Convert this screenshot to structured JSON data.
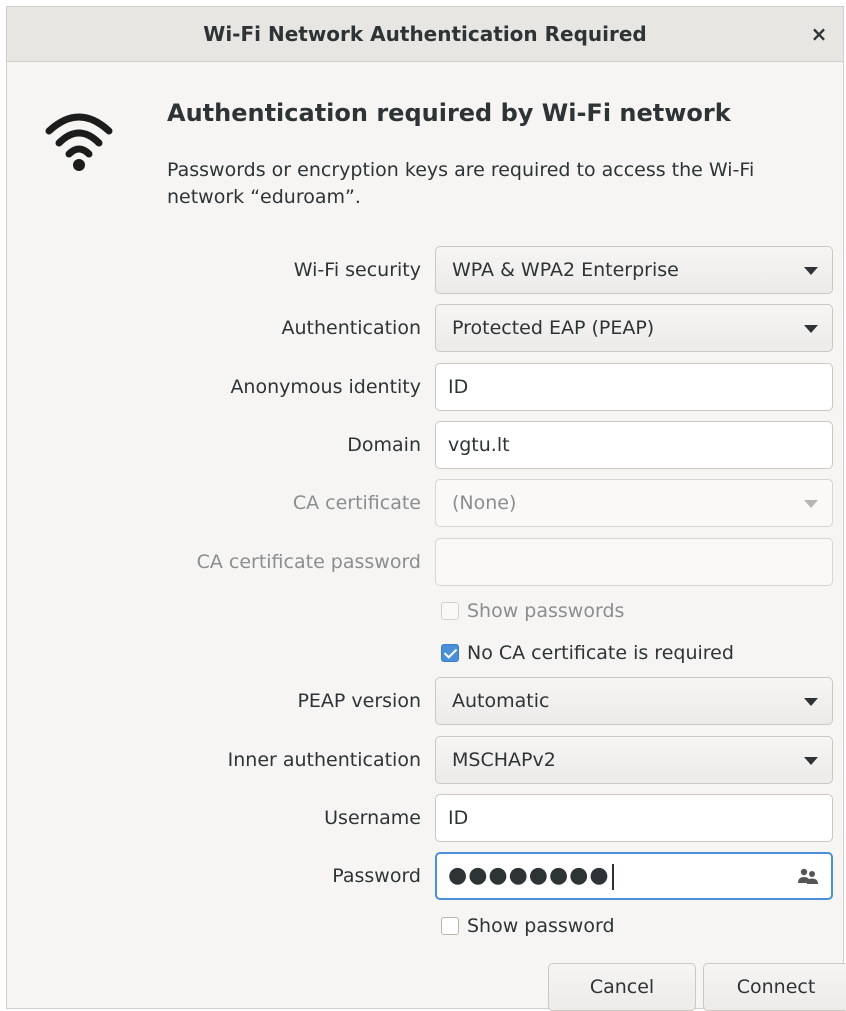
{
  "window": {
    "title": "Wi-Fi Network Authentication Required",
    "close_label": "×"
  },
  "header": {
    "icon": "wifi-icon",
    "heading": "Authentication required by Wi-Fi network",
    "description": "Passwords or encryption keys are required to access the Wi-Fi network “eduroam”."
  },
  "form": {
    "wifi_security": {
      "label": "Wi-Fi security",
      "value": "WPA & WPA2 Enterprise"
    },
    "authentication": {
      "label": "Authentication",
      "value": "Protected EAP (PEAP)"
    },
    "anonymous_identity": {
      "label": "Anonymous identity",
      "value": "ID"
    },
    "domain": {
      "label": "Domain",
      "value": "vgtu.lt"
    },
    "ca_certificate": {
      "label": "CA certificate",
      "value": "(None)"
    },
    "ca_certificate_password": {
      "label": "CA certificate password",
      "value": ""
    },
    "show_passwords": {
      "label": "Show passwords",
      "checked": false
    },
    "no_ca_required": {
      "label": "No CA certificate is required",
      "checked": true
    },
    "peap_version": {
      "label": "PEAP version",
      "value": "Automatic"
    },
    "inner_authentication": {
      "label": "Inner authentication",
      "value": "MSCHAPv2"
    },
    "username": {
      "label": "Username",
      "value": "ID"
    },
    "password": {
      "label": "Password",
      "value": "●●●●●●●●",
      "icon": "people-icon"
    },
    "show_password": {
      "label": "Show password",
      "checked": false
    }
  },
  "buttons": {
    "cancel": "Cancel",
    "connect": "Connect"
  },
  "colors": {
    "accent": "#4a90d9",
    "background": "#f6f5f4",
    "titlebar": "#e8e6e3"
  }
}
